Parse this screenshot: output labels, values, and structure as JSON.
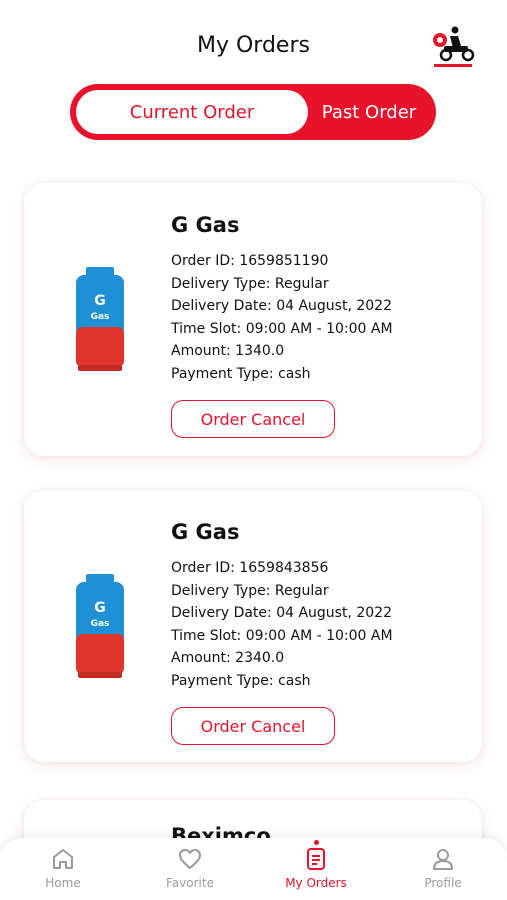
{
  "header": {
    "title": "My Orders",
    "logo_icon": "gas-delivery-logo-icon"
  },
  "tabs": [
    {
      "label": "Current Order",
      "active": true
    },
    {
      "label": "Past Order",
      "active": false
    }
  ],
  "orders": [
    {
      "product_name": "G Gas",
      "order_id": "Order ID: 1659851190",
      "delivery_type": "Delivery Type: Regular",
      "delivery_date": "Delivery Date: 04 August, 2022",
      "time_slot": "Time Slot: 09:00 AM - 10:00 AM",
      "amount": "Amount: 1340.0",
      "payment_type": "Payment Type: cash",
      "cancel_label": "Order Cancel"
    },
    {
      "product_name": "G Gas",
      "order_id": "Order ID: 1659843856",
      "delivery_type": "Delivery Type: Regular",
      "delivery_date": "Delivery Date: 04 August, 2022",
      "time_slot": "Time Slot: 09:00 AM - 10:00 AM",
      "amount": "Amount: 2340.0",
      "payment_type": "Payment Type: cash",
      "cancel_label": "Order Cancel"
    },
    {
      "product_name": "Beximco"
    }
  ],
  "nav": [
    {
      "label": "Home",
      "icon": "home-icon"
    },
    {
      "label": "Favorite",
      "icon": "heart-icon"
    },
    {
      "label": "My Orders",
      "icon": "orders-icon",
      "active": true
    },
    {
      "label": "Profile",
      "icon": "profile-icon"
    }
  ],
  "colors": {
    "accent": "#e8132b",
    "cylinder_blue": "#1f8fd6",
    "cylinder_red": "#e0352b",
    "inactive_nav": "#9a9a9a"
  }
}
